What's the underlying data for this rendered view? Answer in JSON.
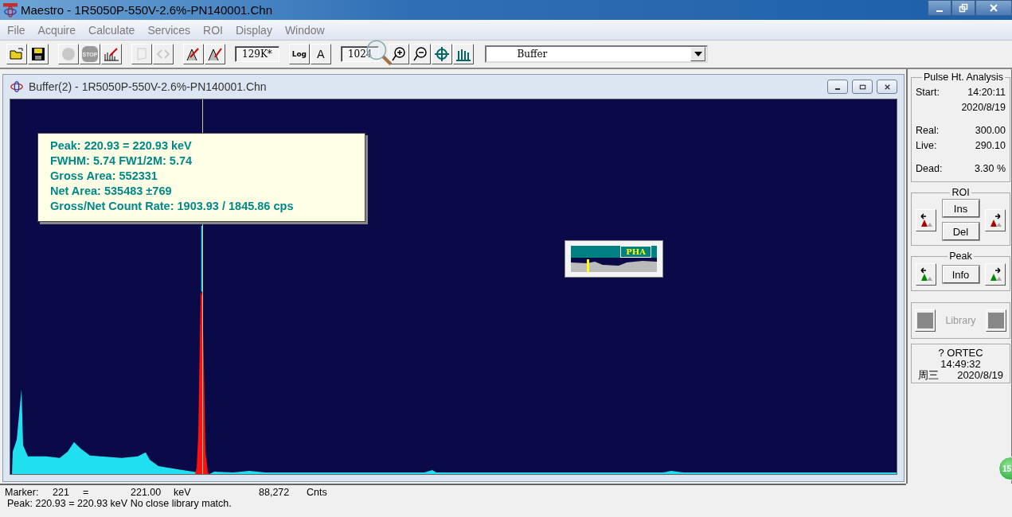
{
  "window": {
    "title": "Maestro - 1R5050P-550V-2.6%-PN140001.Chn"
  },
  "menu": [
    "File",
    "Acquire",
    "Calculate",
    "Services",
    "ROI",
    "Display",
    "Window"
  ],
  "toolbar": {
    "buttons": [
      {
        "disabled": false
      },
      {
        "disabled": false
      },
      {
        "disabled": true
      },
      {
        "disabled": true,
        "label": "STOP"
      },
      {
        "disabled": false
      },
      {
        "disabled": true
      },
      {
        "disabled": true
      },
      {
        "disabled": false
      },
      {
        "disabled": false
      },
      {
        "disabled": false
      },
      {
        "disabled": false
      },
      {
        "disabled": false
      },
      {
        "disabled": false
      }
    ],
    "counts": "129K*",
    "log": "Log",
    "auto": "A",
    "scale": "1024",
    "detector": "Buffer"
  },
  "buffer_window": {
    "title": "Buffer(2) - 1R5050P-550V-2.6%-PN140001.Chn",
    "peak_info": [
      "Peak: 220.93 = 220.93 keV",
      "FWHM: 5.74  FW1/2M: 5.74",
      "Gross Area: 552331",
      "Net Area: 535483 ±769",
      "Gross/Net Count Rate: 1903.93 / 1845.86 cps"
    ],
    "overview": {
      "label": "PHA"
    }
  },
  "side_panel": {
    "pulse_analysis": {
      "title": "Pulse Ht. Analysis",
      "rows": [
        {
          "label": "Start:",
          "value": "14:20:11"
        },
        {
          "value": "2020/8/19"
        },
        {
          "label": "Real:",
          "value": "300.00"
        },
        {
          "label": "Live:",
          "value": "290.10"
        },
        {
          "label": "Dead:",
          "value": "3.30  %"
        }
      ]
    },
    "roi": {
      "title": "ROI",
      "insert": "Ins",
      "delete": "Del"
    },
    "peak": {
      "title": "Peak",
      "info": "Info"
    },
    "library": {
      "label": "Library",
      "disabled": true
    },
    "clock": {
      "title": "? ORTEC",
      "time": "14:49:32",
      "weekday": "周三",
      "date": "2020/8/19"
    }
  },
  "status_bar": {
    "marker_label": "Marker:",
    "channel": "221",
    "equals": "=",
    "energy": "221.00",
    "unit": "keV",
    "counts": "88,272",
    "counts_unit": "Cnts",
    "peak_line": "Peak: 220.93 = 220.93 keV  No close library match."
  },
  "badge": "15"
}
